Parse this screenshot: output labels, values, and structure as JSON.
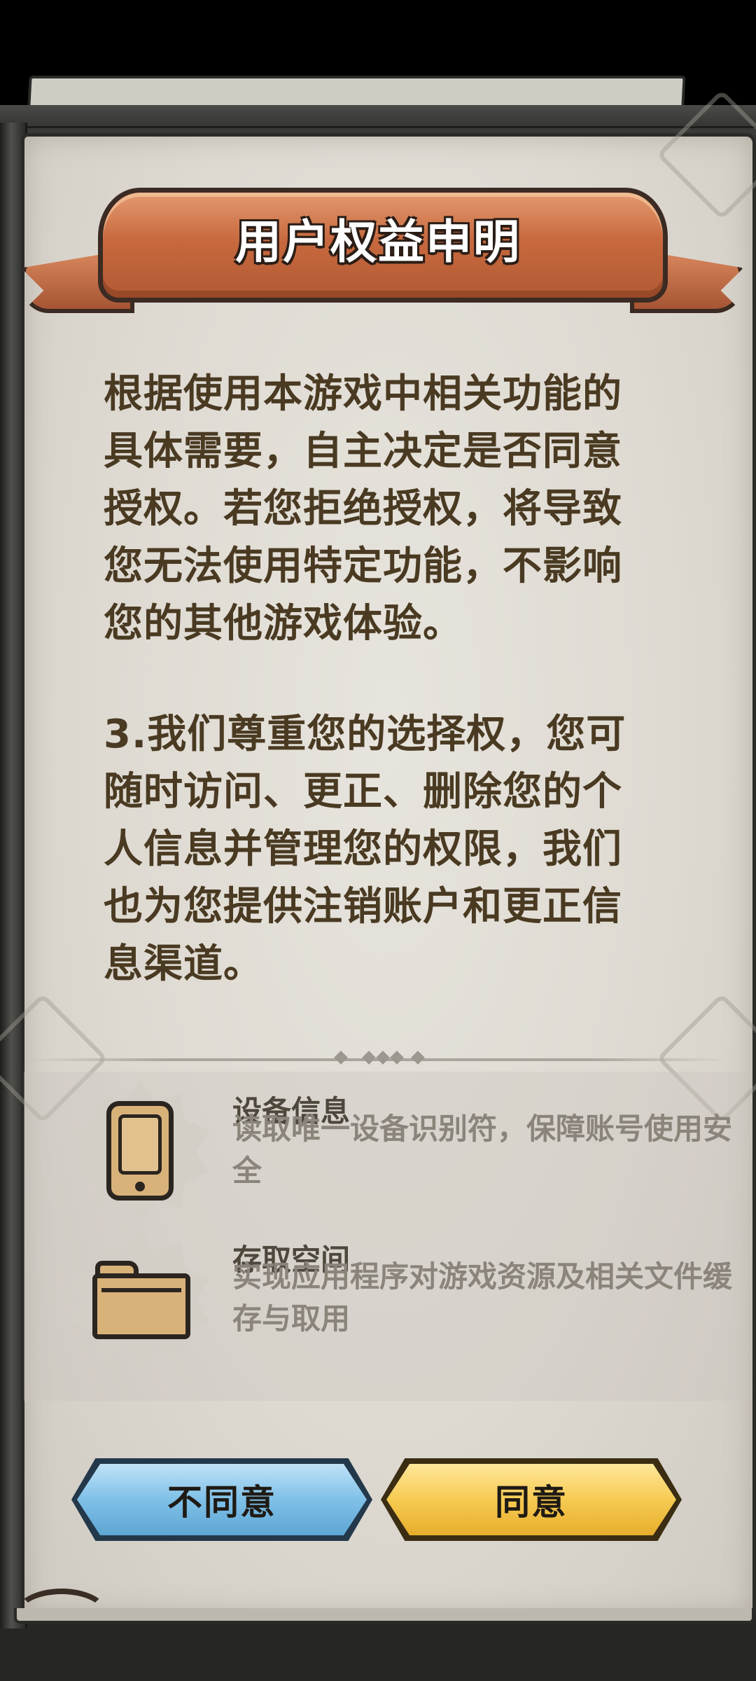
{
  "dialog": {
    "title": "用户权益申明",
    "paragraph_1": "根据使用本游戏中相关功能的具体需要，自主决定是否同意授权。若您拒绝授权，将导致您无法使用特定功能，不影响您的其他游戏体验。",
    "paragraph_2": "3.我们尊重您的选择权，您可随时访问、更正、删除您的个人信息并管理您的权限，我们也为您提供注销账户和更正信息渠道。"
  },
  "permissions": [
    {
      "icon": "phone-icon",
      "title": "设备信息",
      "description": "读取唯一设备识别符，保障账号使用安全"
    },
    {
      "icon": "folder-icon",
      "title": "存取空间",
      "description": "实现应用程序对游戏资源及相关文件缓存与取用"
    }
  ],
  "buttons": {
    "disagree_label": "不同意",
    "agree_label": "同意"
  },
  "colors": {
    "page": "#dedad2",
    "banner": "#c8693f",
    "text": "#4a3a22",
    "disagree_button": "#7fc0e8",
    "agree_button": "#f6cb52"
  }
}
